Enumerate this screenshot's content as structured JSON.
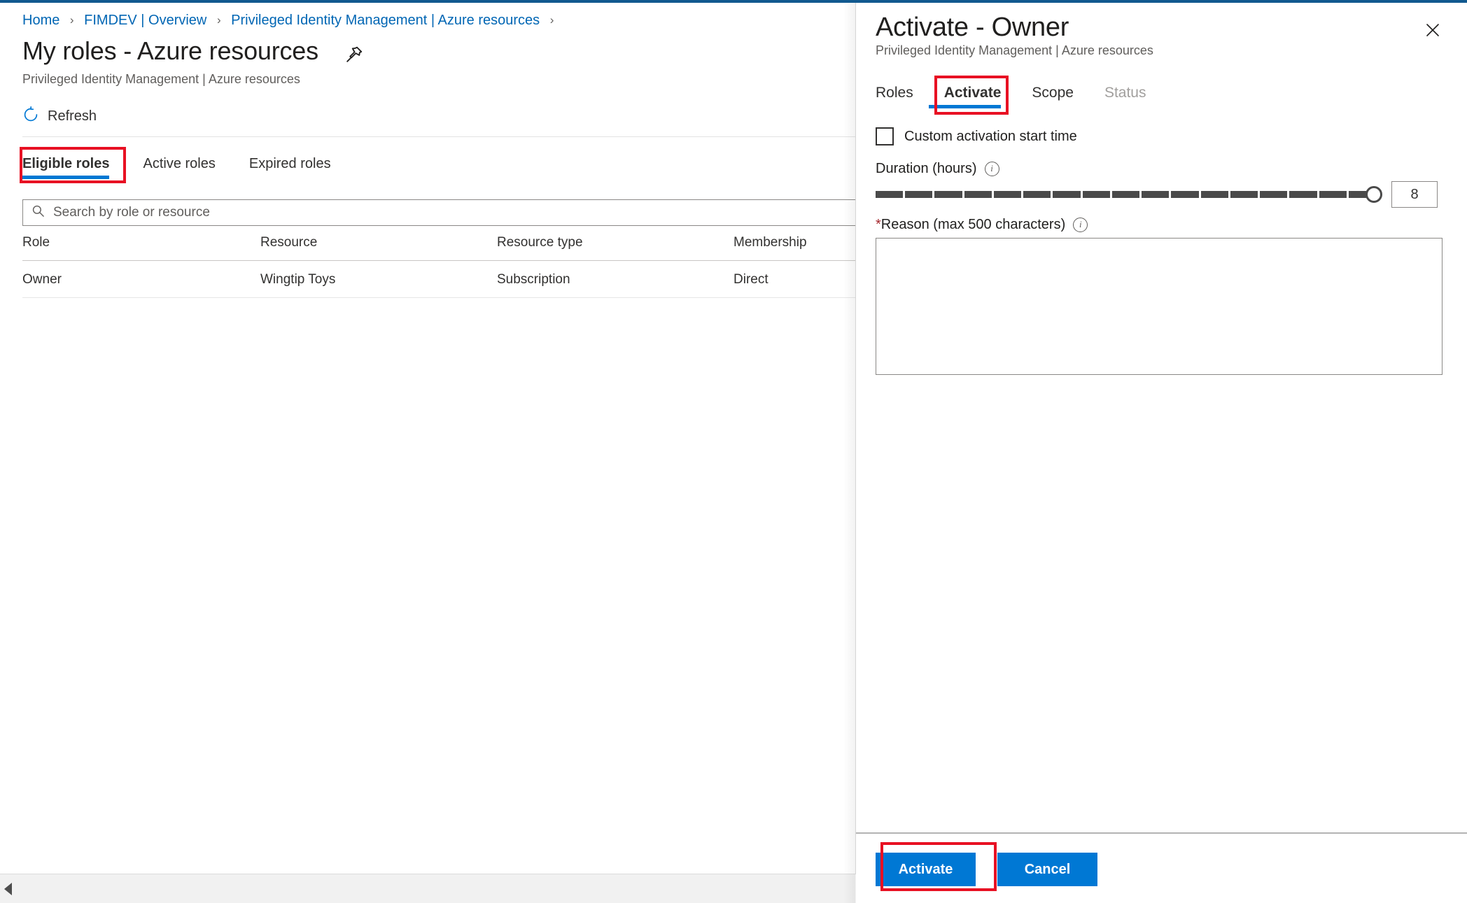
{
  "theme": {
    "accent": "#0078d4",
    "top_accent": "#11598f",
    "annotation": "#e81123",
    "link": "#0066b4",
    "required": "#a4262c"
  },
  "breadcrumb": {
    "items": [
      {
        "label": "Home"
      },
      {
        "label": "FIMDEV | Overview"
      },
      {
        "label": "Privileged Identity Management | Azure resources"
      }
    ],
    "separator": "›"
  },
  "header": {
    "title": "My roles - Azure resources",
    "subtitle": "Privileged Identity Management | Azure resources",
    "pin_icon": "pin-icon"
  },
  "commandbar": {
    "refresh_label": "Refresh",
    "refresh_icon": "refresh-icon"
  },
  "tabs": {
    "items": [
      {
        "label": "Eligible roles",
        "selected": true
      },
      {
        "label": "Active roles",
        "selected": false
      },
      {
        "label": "Expired roles",
        "selected": false
      }
    ]
  },
  "search": {
    "placeholder": "Search by role or resource",
    "value": "",
    "icon": "search-icon"
  },
  "grid": {
    "columns": [
      "Role",
      "Resource",
      "Resource type",
      "Membership"
    ],
    "rows": [
      {
        "role": "Owner",
        "resource": "Wingtip Toys",
        "resource_type": "Subscription",
        "membership": "Direct"
      }
    ]
  },
  "panel": {
    "title": "Activate - Owner",
    "subtitle": "Privileged Identity Management | Azure resources",
    "close_icon": "close-icon",
    "tabs": [
      {
        "label": "Roles",
        "selected": false,
        "disabled": false
      },
      {
        "label": "Activate",
        "selected": true,
        "disabled": false
      },
      {
        "label": "Scope",
        "selected": false,
        "disabled": false
      },
      {
        "label": "Status",
        "selected": false,
        "disabled": true
      }
    ],
    "custom_start": {
      "label": "Custom activation start time",
      "checked": false
    },
    "duration": {
      "label": "Duration (hours)",
      "info_icon": "info-icon",
      "value": "8",
      "min": 1,
      "max": 8,
      "ticks": 17
    },
    "reason": {
      "label_star": "*",
      "label": "Reason (max 500 characters)",
      "info_icon": "info-icon",
      "value": "",
      "maxlength": 500
    },
    "footer": {
      "activate_label": "Activate",
      "cancel_label": "Cancel"
    }
  },
  "scrollbar": {
    "left_arrow_icon": "caret-left-icon"
  }
}
